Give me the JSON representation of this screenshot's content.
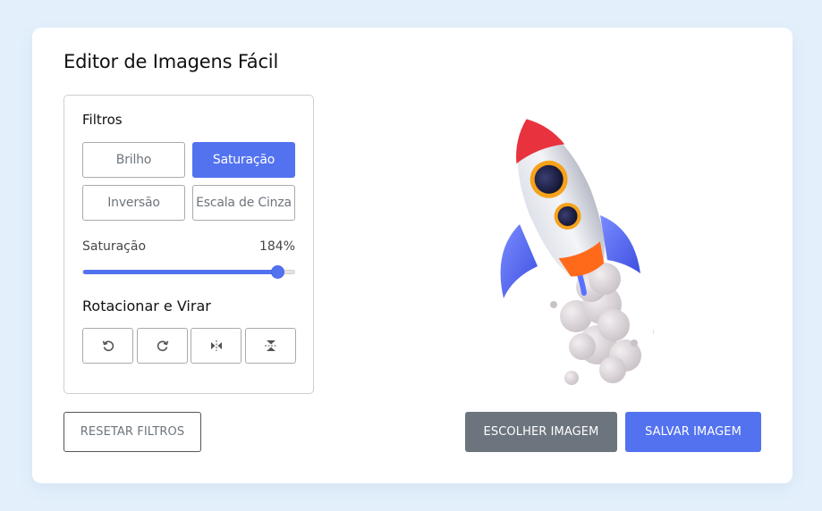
{
  "app": {
    "title": "Editor de Imagens Fácil"
  },
  "filters": {
    "heading": "Filtros",
    "options": [
      {
        "label": "Brilho",
        "active": false
      },
      {
        "label": "Saturação",
        "active": true
      },
      {
        "label": "Inversão",
        "active": false
      },
      {
        "label": "Escala de Cinza",
        "active": false
      }
    ],
    "slider": {
      "name": "Saturação",
      "value_text": "184%",
      "value": 184,
      "max": 200
    }
  },
  "rotate": {
    "heading": "Rotacionar e Virar",
    "buttons": [
      {
        "icon": "rotate-left-icon"
      },
      {
        "icon": "rotate-right-icon"
      },
      {
        "icon": "flip-horizontal-icon"
      },
      {
        "icon": "flip-vertical-icon"
      }
    ]
  },
  "actions": {
    "reset": "RESETAR FILTROS",
    "choose": "ESCOLHER IMAGEM",
    "save": "SALVAR IMAGEM"
  },
  "colors": {
    "accent": "#5372f0",
    "secondary": "#6c757d",
    "background": "#e3f0fc"
  }
}
